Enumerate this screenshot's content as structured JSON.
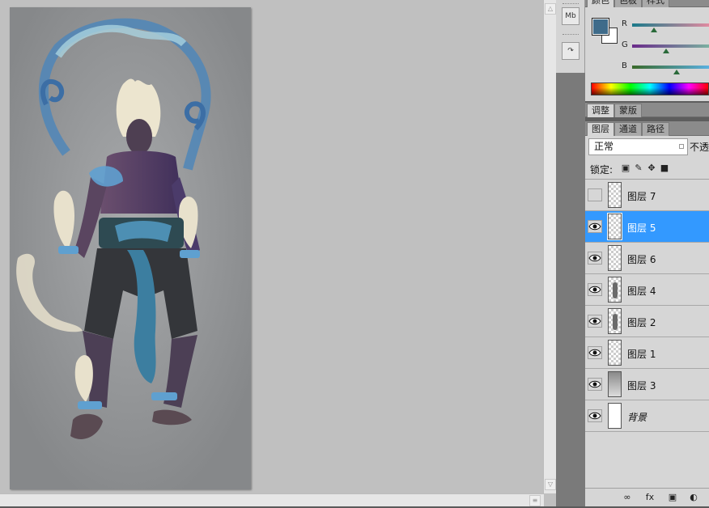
{
  "color_panel": {
    "tabs": [
      "颜色",
      "色板",
      "样式"
    ],
    "active_tab": 0,
    "foreground_color": "#3e6b8a",
    "background_color": "#ffffff",
    "channels": [
      {
        "label": "R",
        "gradient": [
          "#1a7a8a",
          "#e08aa0"
        ],
        "value_fraction": 0.28
      },
      {
        "label": "G",
        "gradient": [
          "#6a2a8a",
          "#7ab0a0"
        ],
        "value_fraction": 0.44
      },
      {
        "label": "B",
        "gradient": [
          "#3a6a2a",
          "#5ab0e0"
        ],
        "value_fraction": 0.58
      }
    ]
  },
  "adjust_tabs": [
    "调整",
    "蒙版"
  ],
  "layers_tabs": [
    "图层",
    "通道",
    "路径"
  ],
  "layers_panel": {
    "blend_mode": "正常",
    "opacity_label": "不透",
    "lock_label": "锁定:"
  },
  "layers": [
    {
      "name": "图层 7",
      "visible": false,
      "selected": false,
      "thumb": "transparent"
    },
    {
      "name": "图层 5",
      "visible": true,
      "selected": true,
      "thumb": "transparent"
    },
    {
      "name": "图层 6",
      "visible": true,
      "selected": false,
      "thumb": "transparent"
    },
    {
      "name": "图层 4",
      "visible": true,
      "selected": false,
      "thumb": "figure"
    },
    {
      "name": "图层 2",
      "visible": true,
      "selected": false,
      "thumb": "figure"
    },
    {
      "name": "图层 1",
      "visible": true,
      "selected": false,
      "thumb": "transparent"
    },
    {
      "name": "图层 3",
      "visible": true,
      "selected": false,
      "thumb": "gradient"
    },
    {
      "name": "背景",
      "visible": true,
      "selected": false,
      "thumb": "white"
    }
  ],
  "dock": {
    "mini_bridge_label": "Mb"
  }
}
